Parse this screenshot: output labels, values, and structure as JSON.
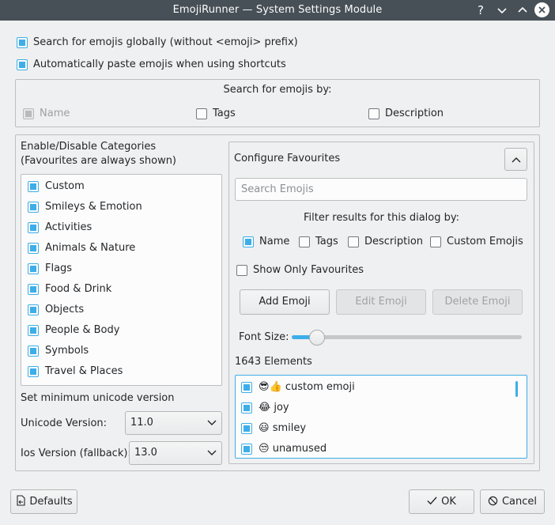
{
  "window": {
    "title": "EmojiRunner — System Settings Module"
  },
  "options": {
    "search_globally": {
      "label": "Search for emojis globally (without <emoji> prefix)",
      "checked": true
    },
    "auto_paste": {
      "label": "Automatically paste emojis when using shortcuts",
      "checked": true
    }
  },
  "search_by": {
    "title": "Search for emojis by:",
    "items": [
      {
        "label": "Name",
        "checked": true,
        "enabled": false
      },
      {
        "label": "Tags",
        "checked": false,
        "enabled": true
      },
      {
        "label": "Description",
        "checked": false,
        "enabled": true
      }
    ]
  },
  "categories": {
    "title_line1": "Enable/Disable Categories",
    "title_line2": "(Favourites are always shown)",
    "items": [
      {
        "label": "Custom",
        "checked": true
      },
      {
        "label": "Smileys & Emotion",
        "checked": true
      },
      {
        "label": "Activities",
        "checked": true
      },
      {
        "label": "Animals & Nature",
        "checked": true
      },
      {
        "label": "Flags",
        "checked": true
      },
      {
        "label": "Food & Drink",
        "checked": true
      },
      {
        "label": "Objects",
        "checked": true
      },
      {
        "label": "People & Body",
        "checked": true
      },
      {
        "label": "Symbols",
        "checked": true
      },
      {
        "label": "Travel & Places",
        "checked": true
      }
    ]
  },
  "unicode": {
    "section_title": "Set minimum unicode version",
    "unicode_label": "Unicode Version:",
    "unicode_value": "11.0",
    "ios_label": "Ios Version (fallback):",
    "ios_value": "13.0"
  },
  "favourites": {
    "title": "Configure Favourites",
    "search_placeholder": "Search Emojis",
    "filter_title": "Filter results for this dialog by:",
    "filters": [
      {
        "label": "Name",
        "checked": true
      },
      {
        "label": "Tags",
        "checked": false
      },
      {
        "label": "Description",
        "checked": false
      },
      {
        "label": "Custom Emojis",
        "checked": false
      }
    ],
    "show_only_favourites": {
      "label": "Show Only Favourites",
      "checked": false
    },
    "add_label": "Add Emoji",
    "edit_label": "Edit Emoji",
    "delete_label": "Delete Emoji",
    "font_size_label": "Font Size:",
    "font_size_fraction": 0.08,
    "elements_count": "1643 Elements",
    "emojis": [
      {
        "icons": [
          "😎",
          "👍"
        ],
        "label": "custom emoji",
        "checked": true
      },
      {
        "icons": [
          "😂"
        ],
        "label": "joy",
        "checked": true
      },
      {
        "icons": [
          "😃"
        ],
        "label": "smiley",
        "checked": true
      },
      {
        "icons": [
          "😒"
        ],
        "label": "unamused",
        "checked": true
      }
    ]
  },
  "footer": {
    "defaults_label": "Defaults",
    "ok_label": "OK",
    "cancel_label": "Cancel"
  },
  "colors": {
    "accent": "#3daee9",
    "titlebar": "#475057",
    "background": "#eff0f1"
  }
}
